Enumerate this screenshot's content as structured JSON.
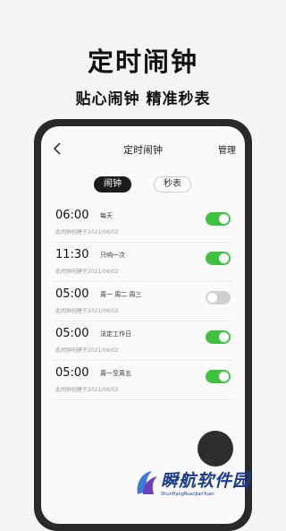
{
  "promo": {
    "title": "定时闹钟",
    "subtitle": "贴心闹钟  精准秒表"
  },
  "nav": {
    "back_icon": "chevron-left-icon",
    "title": "定时闹钟",
    "manage_label": "管理"
  },
  "tabs": [
    {
      "label": "闹钟",
      "active": true
    },
    {
      "label": "秒表",
      "active": false
    }
  ],
  "alarms": [
    {
      "time": "06:00",
      "repeat": "每天",
      "created": "此闹钟创建于2021/06/02",
      "enabled": true
    },
    {
      "time": "11:30",
      "repeat": "只响一次",
      "created": "此闹钟创建于2021/06/02",
      "enabled": true
    },
    {
      "time": "05:00",
      "repeat": "周一 周二 周三",
      "created": "此闹钟创建于2021/06/02",
      "enabled": false
    },
    {
      "time": "05:00",
      "repeat": "法定工作日",
      "created": "此闹钟创建于2021/06/02",
      "enabled": true
    },
    {
      "time": "05:00",
      "repeat": "周一至周五",
      "created": "此闹钟创建于2021/06/02",
      "enabled": true
    }
  ],
  "colors": {
    "toggle_on": "#3fc23f",
    "toggle_off": "#cfcfcf",
    "tab_active_bg": "#1c1c1c"
  },
  "watermark": {
    "text": "瞬航软件园",
    "subtext": "ShunHangRuanJianYuan"
  }
}
